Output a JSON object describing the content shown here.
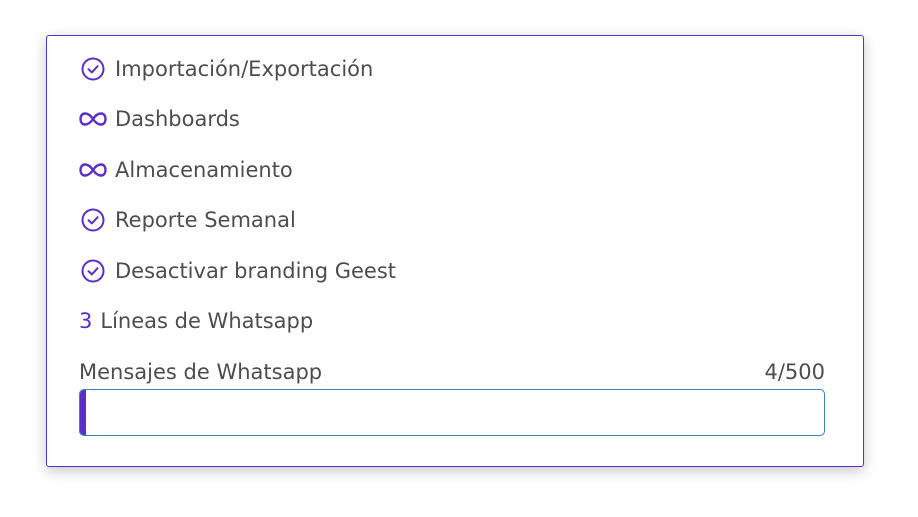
{
  "features": [
    {
      "icon": "check-circle-icon",
      "label": "Importación/Exportación"
    },
    {
      "icon": "infinity-icon",
      "label": "Dashboards"
    },
    {
      "icon": "infinity-icon",
      "label": "Almacenamiento"
    },
    {
      "icon": "check-circle-icon",
      "label": "Reporte Semanal"
    },
    {
      "icon": "check-circle-icon",
      "label": "Desactivar branding Geest"
    }
  ],
  "whatsapp_lines": {
    "count": "3",
    "label": "Líneas de Whatsapp"
  },
  "whatsapp_messages": {
    "label": "Mensajes de Whatsapp",
    "usage": "4/500",
    "used_fraction": 0.008
  },
  "colors": {
    "accent": "#5b2ecb",
    "text": "#4d4d4d",
    "progress_border": "#3b82b8"
  }
}
